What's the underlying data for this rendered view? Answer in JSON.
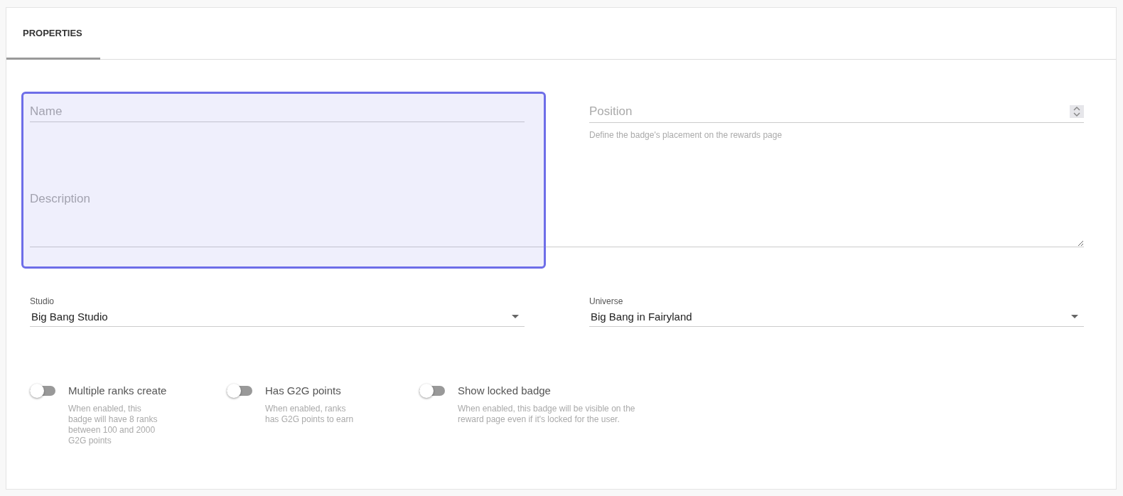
{
  "tabs": [
    {
      "label": "PROPERTIES",
      "selected": true
    }
  ],
  "highlight": true,
  "name_field": {
    "placeholder": "Name"
  },
  "position_field": {
    "placeholder": "Position",
    "help": "Define the badge's placement on the rewards page"
  },
  "description_field": {
    "placeholder": "Description"
  },
  "selects": [
    {
      "label": "Studio",
      "value": "Big Bang Studio"
    },
    {
      "label": "Universe",
      "value": "Big Bang in Fairyland"
    }
  ],
  "toggles": [
    {
      "label": "Multiple ranks create",
      "help": "When enabled, this badge will have 8 ranks between 100 and 2000 G2G points",
      "on": false
    },
    {
      "label": "Has G2G points",
      "help": "When enabled, ranks has G2G points to earn",
      "on": false
    },
    {
      "label": "Show locked badge",
      "help": "When enabled, this badge will be visible on the reward page even if it's locked for the user.",
      "on": false
    }
  ]
}
